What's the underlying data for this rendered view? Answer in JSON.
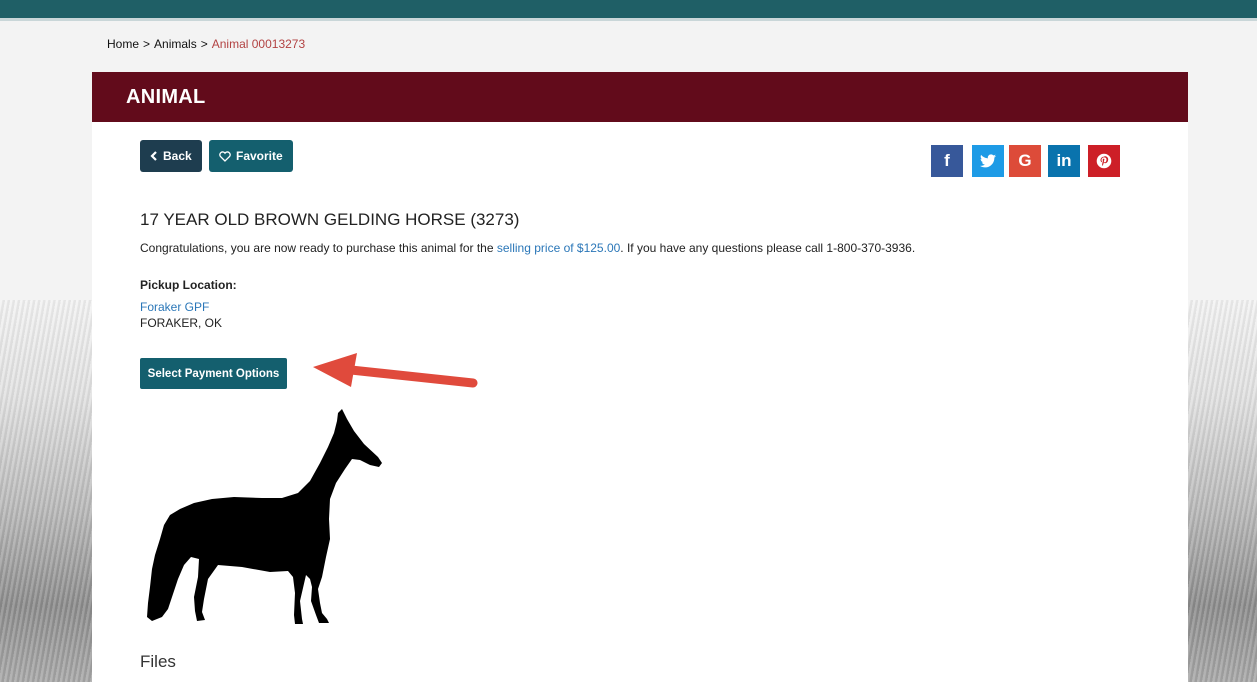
{
  "breadcrumb": {
    "home": "Home",
    "sep1": ">",
    "animals": "Animals",
    "sep2": ">",
    "current": "Animal 00013273"
  },
  "header": {
    "title": "ANIMAL"
  },
  "actions": {
    "back_label": "Back",
    "favorite_label": "Favorite"
  },
  "social": {
    "facebook": "f",
    "google": "G",
    "linkedin": "in"
  },
  "animal": {
    "title": "17 YEAR OLD BROWN GELDING HORSE (3273)",
    "desc_before": "Congratulations, you are now ready to purchase this animal for the ",
    "desc_link": "selling price of $125.00",
    "desc_after": ". If you have any questions please call 1-800-370-3936.",
    "pickup_label": "Pickup Location:",
    "pickup_link": "Foraker GPF",
    "pickup_city": "FORAKER, OK"
  },
  "payment": {
    "button_label": "Select Payment Options"
  },
  "files": {
    "heading": "Files"
  },
  "colors": {
    "header_bg": "#620b1b",
    "button_teal": "#145f6e",
    "button_navy": "#1e3d4f",
    "link": "#2b77b8",
    "arrow": "#e04a3c"
  }
}
